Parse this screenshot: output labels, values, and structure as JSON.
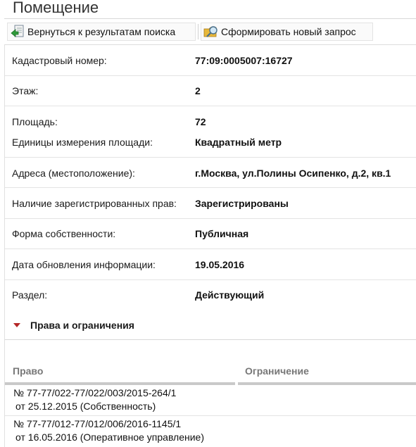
{
  "header": {
    "title": "Помещение"
  },
  "toolbar": {
    "back_label": "Вернуться к результатам поиска",
    "new_label": "Сформировать новый запрос"
  },
  "fields": [
    {
      "label": "Кадастровый номер:",
      "value": "77:09:0005007:16727"
    },
    {
      "label": "Этаж:",
      "value": "2"
    },
    {
      "label": "Площадь:",
      "value": "72"
    },
    {
      "label": "Единицы измерения площади:",
      "value": "Квадратный метр"
    },
    {
      "label": "Адреса (местоположение):",
      "value": "г.Москва, ул.Полины Осипенко, д.2, кв.1"
    },
    {
      "label": "Наличие зарегистрированных прав:",
      "value": "Зарегистрированы"
    },
    {
      "label": "Форма собственности:",
      "value": "Публичная"
    },
    {
      "label": "Дата обновления информации:",
      "value": "19.05.2016"
    },
    {
      "label": "Раздел:",
      "value": "Действующий"
    }
  ],
  "rights_section": {
    "title": "Права и ограничения",
    "columns": [
      "Право",
      "Ограничение"
    ],
    "rows": [
      {
        "line1": "№ 77-77/022-77/022/003/2015-264/1",
        "line2": "от 25.12.2015  (Собственность)",
        "restriction": ""
      },
      {
        "line1": "№ 77-77/012-77/012/006/2016-1145/1",
        "line2": "от 16.05.2016  (Оперативное управление)",
        "restriction": ""
      }
    ]
  }
}
